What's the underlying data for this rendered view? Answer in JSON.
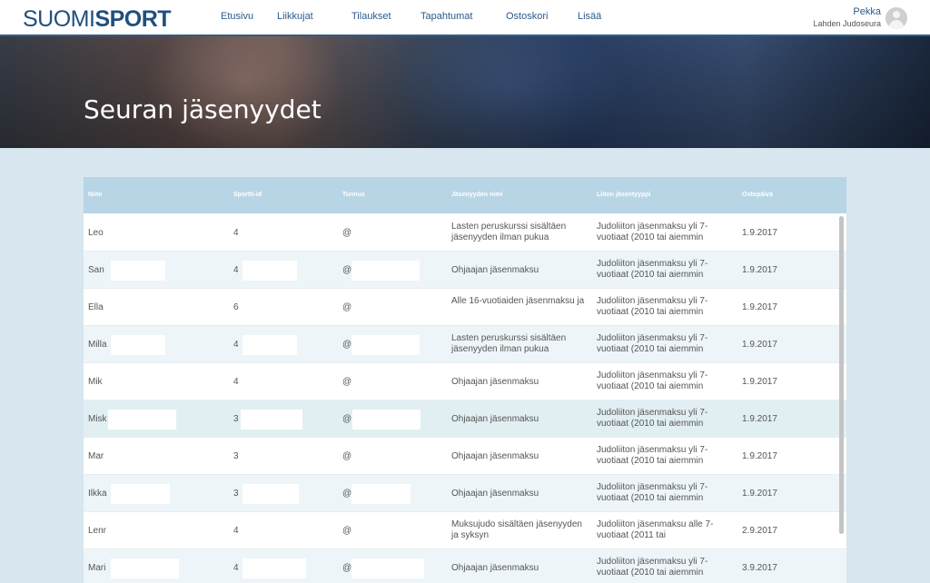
{
  "logo": {
    "light": "SUOMI",
    "bold": "SPORT"
  },
  "nav": [
    "Etusivu",
    "Liikkujat",
    "Tilaukset",
    "Tapahtumat",
    "Ostoskori",
    "Lisää"
  ],
  "user": {
    "name": "Pekka",
    "club": "Lahden Judoseura"
  },
  "hero": {
    "title": "Seuran jäsenyydet"
  },
  "table": {
    "headers": [
      "Nimi",
      "Sportti-id",
      "Tunnus",
      "Jäsenyyden nimi",
      "Liiton jäsentyyppi",
      "Ostopäivä"
    ],
    "rows": [
      {
        "name": "Leo",
        "id": "4",
        "tunnus": "@",
        "membership": "Lasten peruskurssi sisältäen jäsenyyden ilman pukua",
        "fed": "Judoliiton jäsenmaksu yli 7-vuotiaat (2010 tai aiemmin",
        "date": "1.9.2017"
      },
      {
        "name": "San",
        "id": "4",
        "tunnus": "@",
        "membership": "Ohjaajan jäsenmaksu",
        "fed": "Judoliiton jäsenmaksu yli 7-vuotiaat (2010 tai aiemmin",
        "date": "1.9.2017"
      },
      {
        "name": "Ella",
        "id": "6",
        "tunnus": "@",
        "membership": "Alle 16-vuotiaiden jäsenmaksu ja",
        "fed": "Judoliiton jäsenmaksu yli 7-vuotiaat (2010 tai aiemmin",
        "date": "1.9.2017"
      },
      {
        "name": "Milla",
        "id": "4",
        "tunnus": "@",
        "membership": "Lasten peruskurssi sisältäen jäsenyyden ilman pukua",
        "fed": "Judoliiton jäsenmaksu yli 7-vuotiaat (2010 tai aiemmin",
        "date": "1.9.2017"
      },
      {
        "name": "Mik",
        "id": "4",
        "tunnus": "@",
        "membership": "Ohjaajan jäsenmaksu",
        "fed": "Judoliiton jäsenmaksu yli 7-vuotiaat (2010 tai aiemmin",
        "date": "1.9.2017"
      },
      {
        "name": "Misk",
        "id": "3",
        "tunnus": "@",
        "membership": "Ohjaajan jäsenmaksu",
        "fed": "Judoliiton jäsenmaksu yli 7-vuotiaat (2010 tai aiemmin",
        "date": "1.9.2017"
      },
      {
        "name": "Mar",
        "id": "3",
        "tunnus": "@",
        "membership": "Ohjaajan jäsenmaksu",
        "fed": "Judoliiton jäsenmaksu yli 7-vuotiaat (2010 tai aiemmin",
        "date": "1.9.2017"
      },
      {
        "name": "Ilkka",
        "id": "3",
        "tunnus": "@",
        "membership": "Ohjaajan jäsenmaksu",
        "fed": "Judoliiton jäsenmaksu yli 7-vuotiaat (2010 tai aiemmin",
        "date": "1.9.2017"
      },
      {
        "name": "Lenr",
        "id": "4",
        "tunnus": "@",
        "membership": "Muksujudo sisältäen jäsenyyden ja syksyn",
        "fed": "Judoliiton jäsenmaksu alle 7-vuotiaat (2011 tai",
        "date": "2.9.2017"
      },
      {
        "name": "Mari",
        "id": "4",
        "tunnus": "@",
        "membership": "Ohjaajan jäsenmaksu",
        "fed": "Judoliiton jäsenmaksu yli 7-vuotiaat (2010 tai aiemmin",
        "date": "3.9.2017"
      }
    ]
  }
}
